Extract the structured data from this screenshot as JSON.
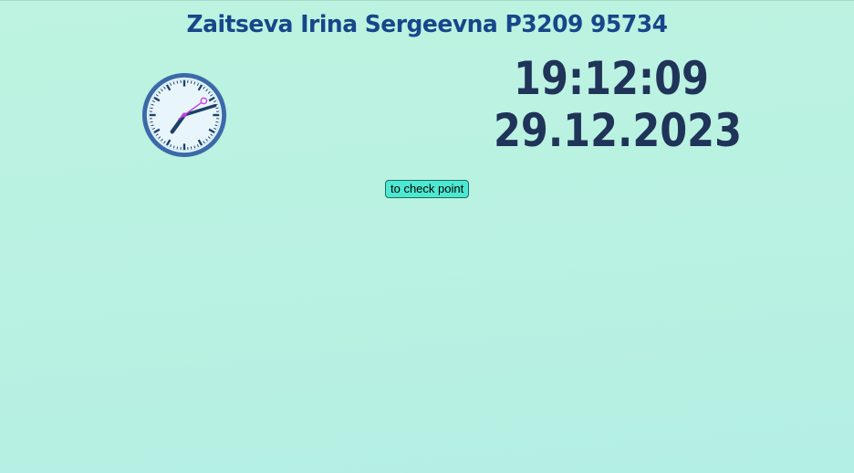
{
  "header": {
    "title": "Zaitseva Irina Sergeevna P3209 95734"
  },
  "clock": {
    "analog": {
      "hour": 19,
      "minute": 12,
      "second": 9
    },
    "time": "19:12:09",
    "date": "29.12.2023"
  },
  "actions": {
    "check_point_label": "to check point"
  },
  "colors": {
    "title": "#17468a",
    "digital": "#1f3458",
    "clock_rim": "#3b6aa8",
    "clock_face": "#e8f6fb",
    "second_hand": "#c040e0",
    "button_bg": "#4de8d2"
  }
}
